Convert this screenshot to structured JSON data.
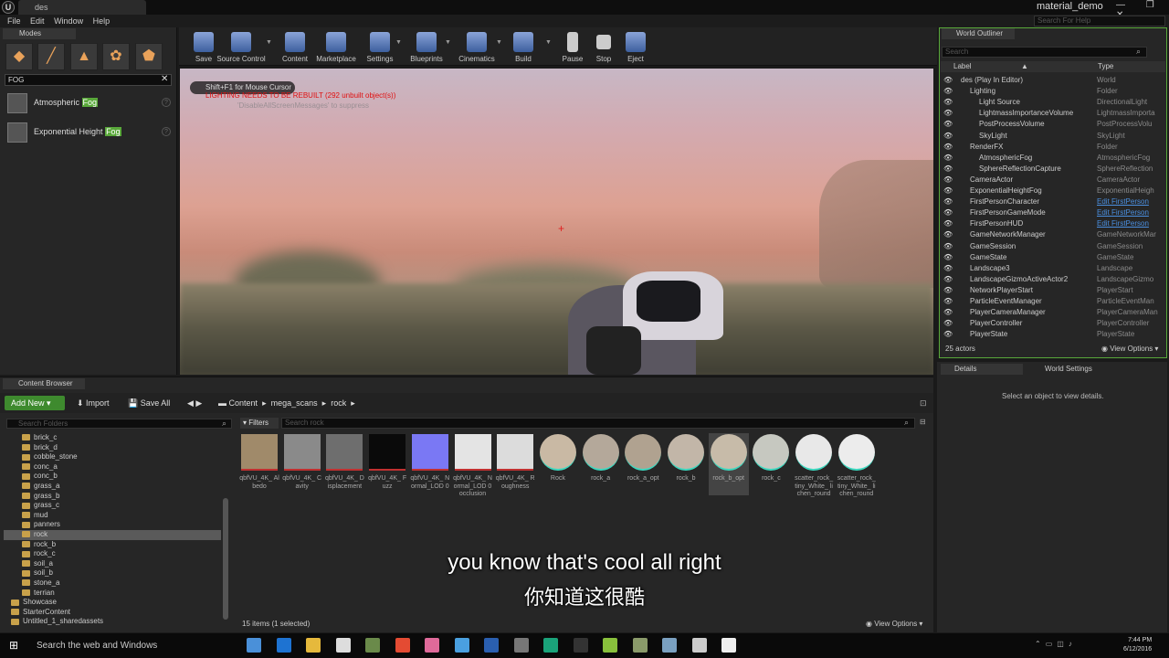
{
  "window": {
    "doc_tab": "des",
    "project_name": "material_demo",
    "controls": "— ❐ ✕",
    "menu": [
      "File",
      "Edit",
      "Window",
      "Help"
    ],
    "help_search_placeholder": "Search For Help"
  },
  "modes": {
    "tab": "Modes",
    "search_value": "FOG",
    "items": [
      {
        "pre": "Atmospheric ",
        "hl": "Fog"
      },
      {
        "pre": "Exponential Height ",
        "hl": "Fog"
      }
    ]
  },
  "toolbar": {
    "buttons": [
      "Save",
      "Source Control",
      "Content",
      "Marketplace",
      "Settings",
      "Blueprints",
      "Cinematics",
      "Build",
      "Pause",
      "Stop",
      "Eject"
    ]
  },
  "viewport": {
    "hint": "Shift+F1 for Mouse Cursor",
    "warning": "LIGHTING NEEDS TO BE REBUILT (292 unbuilt object(s))",
    "suppress": "'DisableAllScreenMessages' to suppress"
  },
  "outliner": {
    "tab": "World Outliner",
    "search_placeholder": "Search",
    "col_label": "Label",
    "col_type": "Type",
    "rows": [
      {
        "label": "des (Play In Editor)",
        "type": "World",
        "indent": 0
      },
      {
        "label": "Lighting",
        "type": "Folder",
        "indent": 1
      },
      {
        "label": "Light Source",
        "type": "DirectionalLight",
        "indent": 2
      },
      {
        "label": "LightmassImportanceVolume",
        "type": "LightmassImporta",
        "indent": 2
      },
      {
        "label": "PostProcessVolume",
        "type": "PostProcessVolu",
        "indent": 2
      },
      {
        "label": "SkyLight",
        "type": "SkyLight",
        "indent": 2
      },
      {
        "label": "RenderFX",
        "type": "Folder",
        "indent": 1
      },
      {
        "label": "AtmosphericFog",
        "type": "AtmosphericFog",
        "indent": 2
      },
      {
        "label": "SphereReflectionCapture",
        "type": "SphereReflection",
        "indent": 2
      },
      {
        "label": "CameraActor",
        "type": "CameraActor",
        "indent": 1
      },
      {
        "label": "ExponentialHeightFog",
        "type": "ExponentialHeigh",
        "indent": 1
      },
      {
        "label": "FirstPersonCharacter",
        "type": "Edit FirstPerson",
        "indent": 1,
        "link": true
      },
      {
        "label": "FirstPersonGameMode",
        "type": "Edit FirstPerson",
        "indent": 1,
        "link": true
      },
      {
        "label": "FirstPersonHUD",
        "type": "Edit FirstPerson",
        "indent": 1,
        "link": true
      },
      {
        "label": "GameNetworkManager",
        "type": "GameNetworkMar",
        "indent": 1
      },
      {
        "label": "GameSession",
        "type": "GameSession",
        "indent": 1
      },
      {
        "label": "GameState",
        "type": "GameState",
        "indent": 1
      },
      {
        "label": "Landscape3",
        "type": "Landscape",
        "indent": 1
      },
      {
        "label": "LandscapeGizmoActiveActor2",
        "type": "LandscapeGizmo",
        "indent": 1
      },
      {
        "label": "NetworkPlayerStart",
        "type": "PlayerStart",
        "indent": 1
      },
      {
        "label": "ParticleEventManager",
        "type": "ParticleEventMan",
        "indent": 1
      },
      {
        "label": "PlayerCameraManager",
        "type": "PlayerCameraMan",
        "indent": 1
      },
      {
        "label": "PlayerController",
        "type": "PlayerController",
        "indent": 1
      },
      {
        "label": "PlayerState",
        "type": "PlayerState",
        "indent": 1
      }
    ],
    "count": "25 actors",
    "view_options": "View Options"
  },
  "details": {
    "tab": "Details",
    "world_settings_tab": "World Settings",
    "empty_message": "Select an object to view details."
  },
  "content_browser": {
    "tab": "Content Browser",
    "add_new": "Add New",
    "import": "Import",
    "save_all": "Save All",
    "breadcrumb": [
      "Content",
      "mega_scans",
      "rock"
    ],
    "folder_search_placeholder": "Search Folders",
    "filters": "Filters",
    "asset_search_placeholder": "Search rock",
    "folders": [
      "brick_c",
      "brick_d",
      "cobble_stone",
      "conc_a",
      "conc_b",
      "grass_a",
      "grass_b",
      "grass_c",
      "mud",
      "panners",
      "rock",
      "rock_b",
      "rock_c",
      "soil_a",
      "soil_b",
      "stone_a",
      "terrian",
      "Showcase",
      "StarterContent",
      "Untitled_1_sharedassets"
    ],
    "selected_folder": "rock",
    "assets": [
      {
        "label": "qbfVU_4K_ Albedo",
        "color": "#a08a6a"
      },
      {
        "label": "qbfVU_4K_ Cavity",
        "color": "#8a8a8a"
      },
      {
        "label": "qbfVU_4K_ Displacement",
        "color": "#6e6e6e"
      },
      {
        "label": "qbfVU_4K_ Fuzz",
        "color": "#0a0a0a"
      },
      {
        "label": "qbfVU_4K_ Normal_LOD 0",
        "color": "#7a78f4"
      },
      {
        "label": "qbfVU_4K_ Normal_LOD 0 occlusion",
        "color": "#e4e4e4"
      },
      {
        "label": "qbfVU_4K_ Roughness",
        "color": "#dcdcdc"
      },
      {
        "label": "Rock",
        "color": "#c9b9a4"
      },
      {
        "label": "rock_a",
        "color": "#b4a89a"
      },
      {
        "label": "rock_a_opt",
        "color": "#b0a290"
      },
      {
        "label": "rock_b",
        "color": "#c2b6a8"
      },
      {
        "label": "rock_b_opt",
        "color": "#c7bba9"
      },
      {
        "label": "rock_c",
        "color": "#c6c8c0"
      },
      {
        "label": "scatter_rock_ tiny_White_ lichen_round",
        "color": "#e8e8e8"
      },
      {
        "label": "scatter_rock_ tiny_White_ lichen_round",
        "color": "#ececec"
      }
    ],
    "selected_asset_index": 11,
    "count": "15 items (1 selected)",
    "view_options": "View Options"
  },
  "subtitles": {
    "en": "you know that's cool all right",
    "zh": "你知道这很酷"
  },
  "taskbar": {
    "search": "Search the web and Windows",
    "time": "7:44 PM",
    "date": "6/12/2016",
    "icon_colors": [
      "#4a90d9",
      "#1e73d2",
      "#e6b93c",
      "#ddd",
      "#6a8a4a",
      "#e44b33",
      "#e06a9a",
      "#4aa0e0",
      "#2a5fb0",
      "#777",
      "#1aa37a",
      "#333",
      "#88c03c",
      "#8a9a6a",
      "#7aa0c0",
      "#ccc",
      "#eee"
    ]
  }
}
